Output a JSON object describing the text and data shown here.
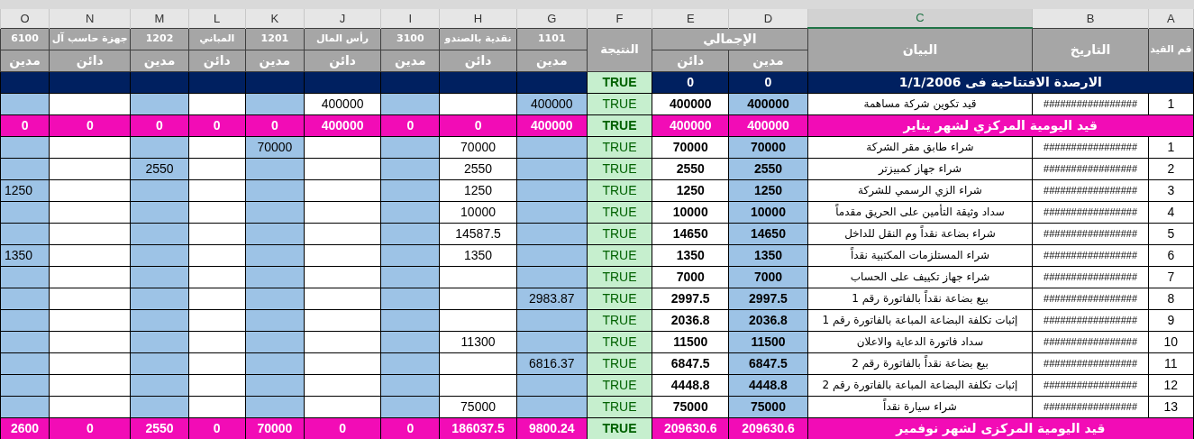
{
  "columns": [
    {
      "letter": "O",
      "selected": false
    },
    {
      "letter": "N",
      "selected": false
    },
    {
      "letter": "M",
      "selected": false
    },
    {
      "letter": "L",
      "selected": false
    },
    {
      "letter": "K",
      "selected": false
    },
    {
      "letter": "J",
      "selected": false
    },
    {
      "letter": "I",
      "selected": false
    },
    {
      "letter": "H",
      "selected": false
    },
    {
      "letter": "G",
      "selected": false
    },
    {
      "letter": "F",
      "selected": false
    },
    {
      "letter": "E",
      "selected": false
    },
    {
      "letter": "D",
      "selected": false
    },
    {
      "letter": "C",
      "selected": true
    },
    {
      "letter": "B",
      "selected": false
    },
    {
      "letter": "A",
      "selected": false
    }
  ],
  "header": {
    "accounts": {
      "o": {
        "title": "6100",
        "side": "مدين"
      },
      "n": {
        "title": "جهزة حاسب آل",
        "side": "دائن"
      },
      "m": {
        "title": "1202",
        "side": "مدين"
      },
      "l": {
        "title": "المباني",
        "side": "دائن"
      },
      "k": {
        "title": "1201",
        "side": "مدين"
      },
      "j": {
        "title": "رأس المال",
        "side": "دائن"
      },
      "i": {
        "title": "3100",
        "side": "مدين"
      },
      "h": {
        "title": "نقدية بالصندو",
        "side": "دائن"
      },
      "g": {
        "title": "1101",
        "side": "مدين"
      }
    },
    "result": "النتيجة",
    "total": "الإجمالي",
    "credit": "دائن",
    "debit": "مدين",
    "description": "البيان",
    "date": "التاريخ",
    "entry_no": "قم القيد"
  },
  "rows": [
    {
      "kind": "opening",
      "accounts": {},
      "result": "TRUE",
      "credit": "0",
      "debit": "0",
      "description": "الارصدة الافتتاحية فى 1/1/2006"
    },
    {
      "kind": "entry",
      "accounts": {
        "j": "400000",
        "g": "400000"
      },
      "result": "TRUE",
      "credit": "400000",
      "debit": "400000",
      "description": "قيد تكوين شركة مساهمة",
      "date": "#################",
      "number": "1"
    },
    {
      "kind": "total",
      "accounts": {
        "o": "0",
        "n": "0",
        "m": "0",
        "l": "0",
        "k": "0",
        "j": "400000",
        "i": "0",
        "h": "0",
        "g": "400000"
      },
      "result": "TRUE",
      "credit": "400000",
      "debit": "400000",
      "description": "قيد اليومية المركزي لشهر يناير"
    },
    {
      "kind": "entry",
      "accounts": {
        "k": "70000",
        "h": "70000"
      },
      "result": "TRUE",
      "credit": "70000",
      "debit": "70000",
      "description": "شراء طابق مقر الشركة",
      "date": "#################",
      "number": "1"
    },
    {
      "kind": "entry",
      "accounts": {
        "m": "2550",
        "h": "2550"
      },
      "result": "TRUE",
      "credit": "2550",
      "debit": "2550",
      "description": "شراء جهاز كمبيزتر",
      "date": "#################",
      "number": "2"
    },
    {
      "kind": "entry",
      "accounts": {
        "o": "1250",
        "h": "1250"
      },
      "result": "TRUE",
      "credit": "1250",
      "debit": "1250",
      "description": "شراء الزي الرسمي للشركة",
      "date": "#################",
      "number": "3"
    },
    {
      "kind": "entry",
      "accounts": {
        "h": "10000"
      },
      "result": "TRUE",
      "credit": "10000",
      "debit": "10000",
      "description": "سداد وثيقة التأمين على الحريق مقدماً",
      "date": "#################",
      "number": "4"
    },
    {
      "kind": "entry",
      "accounts": {
        "h": "14587.5"
      },
      "result": "TRUE",
      "credit": "14650",
      "debit": "14650",
      "description": "شراء بضاعة نقداً وم النقل للداخل",
      "date": "#################",
      "number": "5"
    },
    {
      "kind": "entry",
      "accounts": {
        "o": "1350",
        "h": "1350"
      },
      "result": "TRUE",
      "credit": "1350",
      "debit": "1350",
      "description": "شراء المستلزمات المكتبية نقداً",
      "date": "#################",
      "number": "6"
    },
    {
      "kind": "entry",
      "accounts": {},
      "result": "TRUE",
      "credit": "7000",
      "debit": "7000",
      "description": "شراء جهاز تكييف على الحساب",
      "date": "#################",
      "number": "7"
    },
    {
      "kind": "entry",
      "accounts": {
        "g": "2983.87"
      },
      "result": "TRUE",
      "credit": "2997.5",
      "debit": "2997.5",
      "description": "بيع بضاعة نقداً بالفاتورة رقم 1",
      "date": "#################",
      "number": "8"
    },
    {
      "kind": "entry",
      "accounts": {},
      "result": "TRUE",
      "credit": "2036.8",
      "debit": "2036.8",
      "description": "إثبات تكلفة البضاعة المباعة بالفاتورة رقم 1",
      "date": "#################",
      "number": "9"
    },
    {
      "kind": "entry",
      "accounts": {
        "h": "11300"
      },
      "result": "TRUE",
      "credit": "11500",
      "debit": "11500",
      "description": "سداد فاتورة الدعاية والاعلان",
      "date": "#################",
      "number": "10"
    },
    {
      "kind": "entry",
      "accounts": {
        "g": "6816.37"
      },
      "result": "TRUE",
      "credit": "6847.5",
      "debit": "6847.5",
      "description": "بيع بضاعة نقداً بالفاتورة رقم 2",
      "date": "#################",
      "number": "11"
    },
    {
      "kind": "entry",
      "accounts": {},
      "result": "TRUE",
      "credit": "4448.8",
      "debit": "4448.8",
      "description": "إثبات تكلفة البضاعة المباعة بالفاتورة رقم 2",
      "date": "#################",
      "number": "12"
    },
    {
      "kind": "entry",
      "accounts": {
        "h": "75000"
      },
      "result": "TRUE",
      "credit": "75000",
      "debit": "75000",
      "description": "شراء سيارة نقداً",
      "date": "#################",
      "number": "13"
    },
    {
      "kind": "total",
      "accounts": {
        "o": "2600",
        "n": "0",
        "m": "2550",
        "l": "0",
        "k": "70000",
        "j": "0",
        "i": "0",
        "h": "186037.5",
        "g": "9800.24"
      },
      "result": "TRUE",
      "credit": "209630.6",
      "debit": "209630.6",
      "description": "قيد اليومية المركزى لشهر نوفمير"
    }
  ]
}
